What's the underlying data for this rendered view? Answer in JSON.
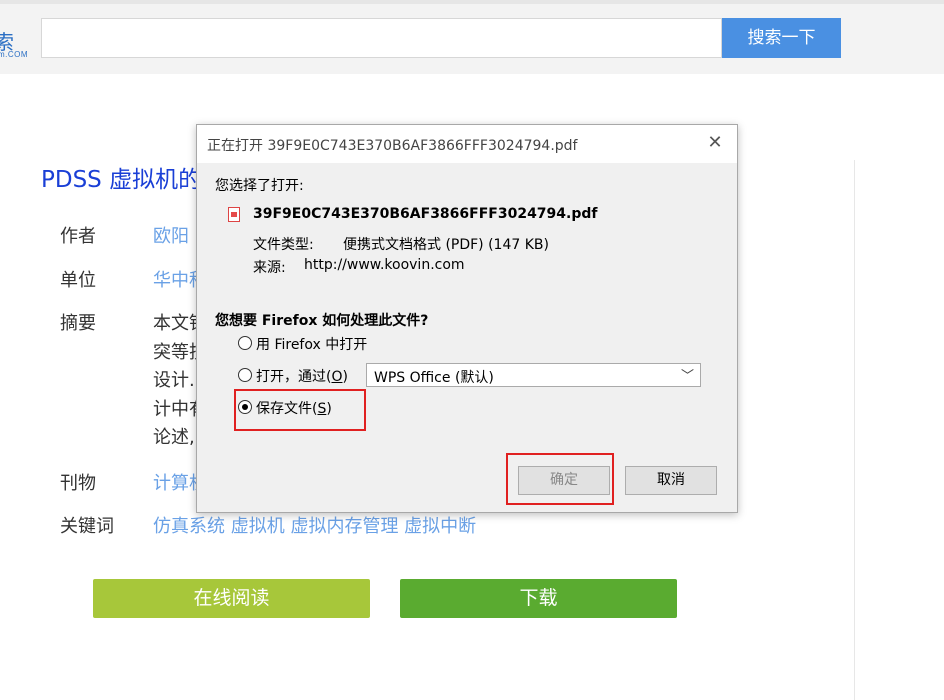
{
  "search": {
    "button_label": "搜索一下",
    "value": ""
  },
  "logo": {
    "glyph": "索",
    "sub": "m.COM"
  },
  "paper": {
    "title": "PDSS 虚拟机的",
    "labels": {
      "author": "作者",
      "unit": "单位",
      "abstract": "摘要",
      "journal": "刊物",
      "keywords": "关键词"
    },
    "author": "欧阳",
    "unit": "华中科",
    "abstract_lines": [
      "本文针",
      "突等技",
      "设计.",
      "计中有",
      "论述,"
    ],
    "journal": "计算机",
    "keywords": "仿真系统 虚拟机 虚拟内存管理 虚拟中断"
  },
  "actions": {
    "read_online": "在线阅读",
    "download": "下载"
  },
  "dialog": {
    "title": "正在打开 39F9E0C743E370B6AF3866FFF3024794.pdf",
    "chosen_label": "您选择了打开:",
    "filename": "39F9E0C743E370B6AF3866FFF3024794.pdf",
    "file_type_label": "文件类型:",
    "file_type_value": "便携式文档格式 (PDF) (147 KB)",
    "source_label": "来源:",
    "source_value": "http://www.koovin.com",
    "question": "您想要 Firefox 如何处理此文件?",
    "option_open_firefox": "用 Firefox 中打开",
    "option_open_with_prefix": "打开，通过(",
    "option_open_with_key": "O",
    "option_open_with_suffix": ")",
    "open_with_app": "WPS Office (默认)",
    "option_save_prefix": "保存文件(",
    "option_save_key": "S",
    "option_save_suffix": ")",
    "selected_option": "save",
    "ok_label": "确定",
    "cancel_label": "取消"
  },
  "colors": {
    "search_button": "#4a90e2",
    "read_button": "#a7c73a",
    "download_button": "#5aab30",
    "highlight": "#e02020",
    "title_link": "#1a3fd6"
  }
}
